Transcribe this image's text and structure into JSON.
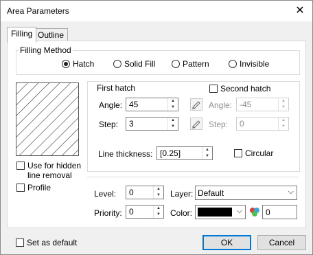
{
  "window": {
    "title": "Area Parameters",
    "close_glyph": "✕"
  },
  "tabs": [
    {
      "label": "Filling",
      "active": true
    },
    {
      "label": "Outline",
      "active": false
    }
  ],
  "filling_method": {
    "label": "Filling Method",
    "options": [
      {
        "label": "Hatch",
        "selected": true
      },
      {
        "label": "Solid Fill",
        "selected": false
      },
      {
        "label": "Pattern",
        "selected": false
      },
      {
        "label": "Invisible",
        "selected": false
      }
    ]
  },
  "first_hatch": {
    "label": "First hatch",
    "angle_label": "Angle:",
    "angle_value": "45",
    "step_label": "Step:",
    "step_value": "3"
  },
  "second_hatch": {
    "label": "Second hatch",
    "checked": false,
    "angle_label": "Angle:",
    "angle_value": "-45",
    "step_label": "Step:",
    "step_value": "0"
  },
  "line_thickness": {
    "label": "Line thickness:",
    "value": "[0.25]"
  },
  "circular": {
    "label": "Circular",
    "checked": false
  },
  "use_for_hidden": {
    "label_line1": "Use for hidden",
    "label_line2": "line removal",
    "checked": false
  },
  "profile": {
    "label": "Profile",
    "checked": false
  },
  "level": {
    "label": "Level:",
    "value": "0"
  },
  "priority": {
    "label": "Priority:",
    "value": "0"
  },
  "layer": {
    "label": "Layer:",
    "value": "Default"
  },
  "color": {
    "label": "Color:",
    "swatch": "#000000",
    "value": "0"
  },
  "set_as_default": {
    "label": "Set as default",
    "checked": false
  },
  "buttons": {
    "ok": "OK",
    "cancel": "Cancel"
  }
}
